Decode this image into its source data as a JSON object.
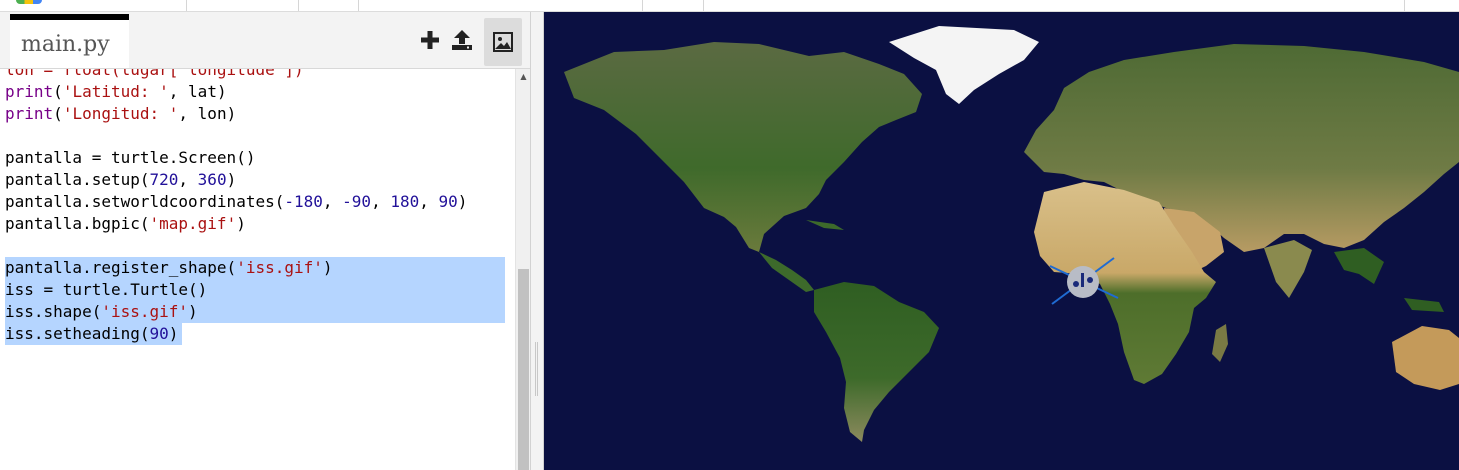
{
  "editor": {
    "tab_label": "main.py",
    "toolbar": {
      "add_file": "plus-icon",
      "upload": "upload-icon",
      "images": "image-icon"
    },
    "code_lines": [
      {
        "segments": [
          {
            "t": "lon = float(lugar['longitude'])",
            "c": "cut"
          }
        ]
      },
      {
        "segments": [
          {
            "t": "print",
            "c": "fn"
          },
          {
            "t": "("
          },
          {
            "t": "'Latitud: '",
            "c": "str"
          },
          {
            "t": ", lat)"
          }
        ]
      },
      {
        "segments": [
          {
            "t": "print",
            "c": "fn"
          },
          {
            "t": "("
          },
          {
            "t": "'Longitud: '",
            "c": "str"
          },
          {
            "t": ", lon)"
          }
        ]
      },
      {
        "segments": [
          {
            "t": ""
          }
        ]
      },
      {
        "segments": [
          {
            "t": "pantalla = turtle.Screen()"
          }
        ]
      },
      {
        "segments": [
          {
            "t": "pantalla.setup("
          },
          {
            "t": "720",
            "c": "num"
          },
          {
            "t": ", "
          },
          {
            "t": "360",
            "c": "num"
          },
          {
            "t": ")"
          }
        ]
      },
      {
        "segments": [
          {
            "t": "pantalla.setworldcoordinates("
          },
          {
            "t": "-180",
            "c": "num"
          },
          {
            "t": ", "
          },
          {
            "t": "-90",
            "c": "num"
          },
          {
            "t": ", "
          },
          {
            "t": "180",
            "c": "num"
          },
          {
            "t": ", "
          },
          {
            "t": "90",
            "c": "num"
          },
          {
            "t": ")"
          }
        ]
      },
      {
        "segments": [
          {
            "t": "pantalla.bgpic("
          },
          {
            "t": "'map.gif'",
            "c": "str"
          },
          {
            "t": ")"
          }
        ]
      },
      {
        "segments": [
          {
            "t": ""
          }
        ]
      },
      {
        "segments": [
          {
            "t": "pantalla.register_shape("
          },
          {
            "t": "'iss.gif'",
            "c": "str"
          },
          {
            "t": ")"
          }
        ],
        "selected": true
      },
      {
        "segments": [
          {
            "t": "iss = turtle.Turtle()"
          }
        ],
        "selected": true
      },
      {
        "segments": [
          {
            "t": "iss.shape("
          },
          {
            "t": "'iss.gif'",
            "c": "str"
          },
          {
            "t": ")"
          }
        ],
        "selected": true
      },
      {
        "segments": [
          {
            "t": "iss.setheading("
          },
          {
            "t": "90",
            "c": "num"
          },
          {
            "t": ")"
          }
        ],
        "selected": "partial"
      }
    ]
  },
  "output": {
    "background": "world-map",
    "turtle_shape": "iss-satellite-icon"
  },
  "colors": {
    "selection": "#b5d5ff",
    "string": "#aa1111",
    "number": "#221199",
    "function": "#770088",
    "ocean": "#0b1042"
  }
}
